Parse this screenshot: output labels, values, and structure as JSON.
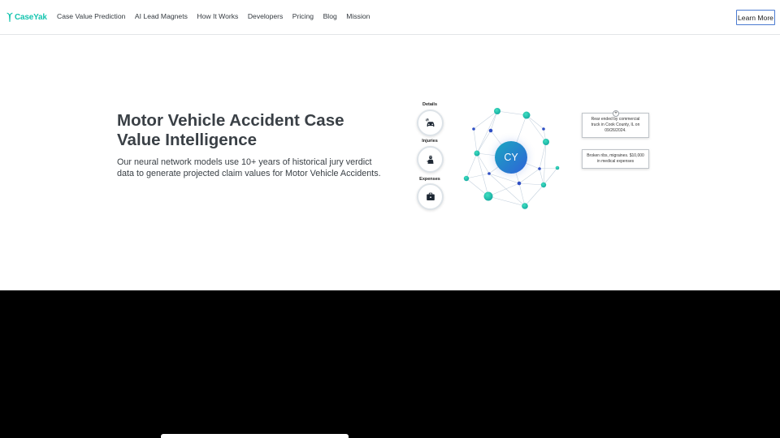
{
  "brand": {
    "name": "CaseYak",
    "accent": "#17c5b0",
    "cy_gradient": [
      "#1aa7c0",
      "#2f62d8"
    ]
  },
  "nav": {
    "links": [
      "Case Value Prediction",
      "AI Lead Magnets",
      "How It Works",
      "Developers",
      "Pricing",
      "Blog",
      "Mission"
    ],
    "cta": "Learn More"
  },
  "hero": {
    "title": "Motor Vehicle Accident Case Value Intelligence",
    "description": "Our neural network models use 10+ years of historical jury verdict data to generate projected claim values for Motor Vehicle Accidents."
  },
  "graphic": {
    "categories": [
      {
        "label": "Details",
        "icon": "car-crash-icon"
      },
      {
        "label": "Injuries",
        "icon": "injured-person-icon"
      },
      {
        "label": "Expenses",
        "icon": "briefcase-icon"
      }
    ],
    "badge": "CY",
    "cards": [
      {
        "text": "Rear ended by commercial truck in Cook County, IL on 09/26/2024."
      },
      {
        "text": "Broken ribs, migraines. $10,000 in medical expenses"
      }
    ],
    "card_plus": "+"
  }
}
